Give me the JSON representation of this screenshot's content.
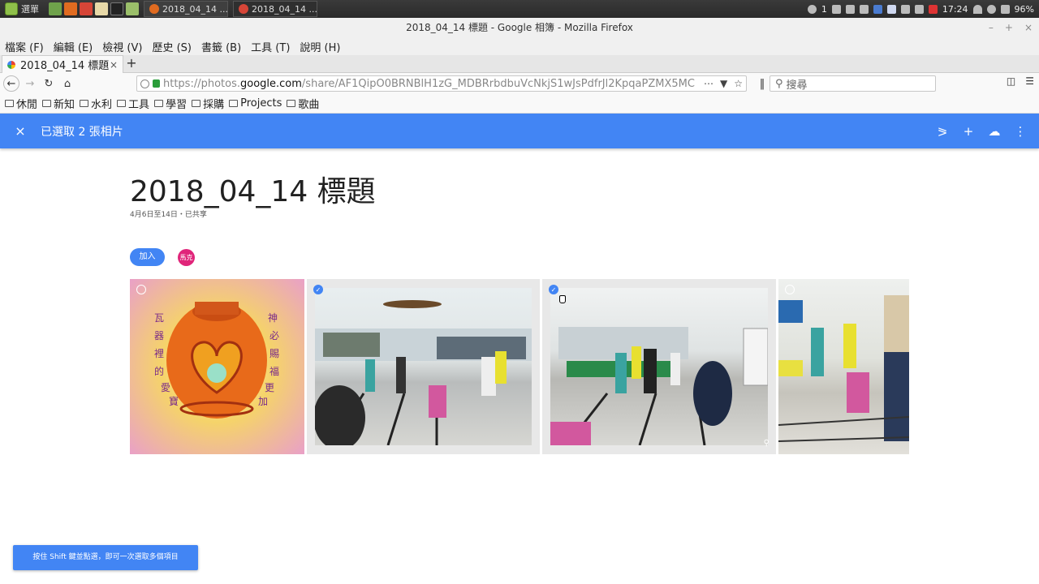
{
  "taskbar": {
    "menu_label": "選單",
    "tasks": [
      {
        "label": "2018_04_14 ..."
      },
      {
        "label": "2018_04_14 ..."
      }
    ],
    "tray": {
      "workspace": "1",
      "clock": "17:24",
      "battery": "96%"
    }
  },
  "window": {
    "title": "2018_04_14 標題 - Google 相簿 - Mozilla Firefox",
    "min": "–",
    "max": "+",
    "close": "×"
  },
  "menubar": [
    "檔案 (F)",
    "編輯 (E)",
    "檢視 (V)",
    "歷史 (S)",
    "書籤 (B)",
    "工具 (T)",
    "說明 (H)"
  ],
  "tab": {
    "label": "2018_04_14 標題",
    "close": "×",
    "new": "+"
  },
  "navbar": {
    "url_prefix": "https://photos.",
    "url_domain": "google.com",
    "url_path": "/share/AF1QipO0BRNBlH1zG_MDBRrbdbuVcNkjS1wJsPdfrJl2KpqaPZMX5MC",
    "search_placeholder": "搜尋"
  },
  "bookmarks": [
    "休閒",
    "新知",
    "水利",
    "工具",
    "學習",
    "採購",
    "Projects",
    "歌曲"
  ],
  "header": {
    "close_icon": "×",
    "title": "已選取 2 張相片"
  },
  "album": {
    "title": "2018_04_14 標題",
    "subtitle": "4月6日至14日・已共享",
    "join_label": "加入",
    "avatar_label": "馬克"
  },
  "photos": [
    {
      "selected": false,
      "description": "jar"
    },
    {
      "selected": true,
      "description": "classroom1"
    },
    {
      "selected": true,
      "description": "classroom2"
    },
    {
      "selected": false,
      "description": "classroom3"
    }
  ],
  "toast": {
    "text": "按住 Shift 鍵並點選，即可一次選取多個項目"
  },
  "colors": {
    "accent": "#4285f4",
    "avatar": "#e0257a"
  }
}
